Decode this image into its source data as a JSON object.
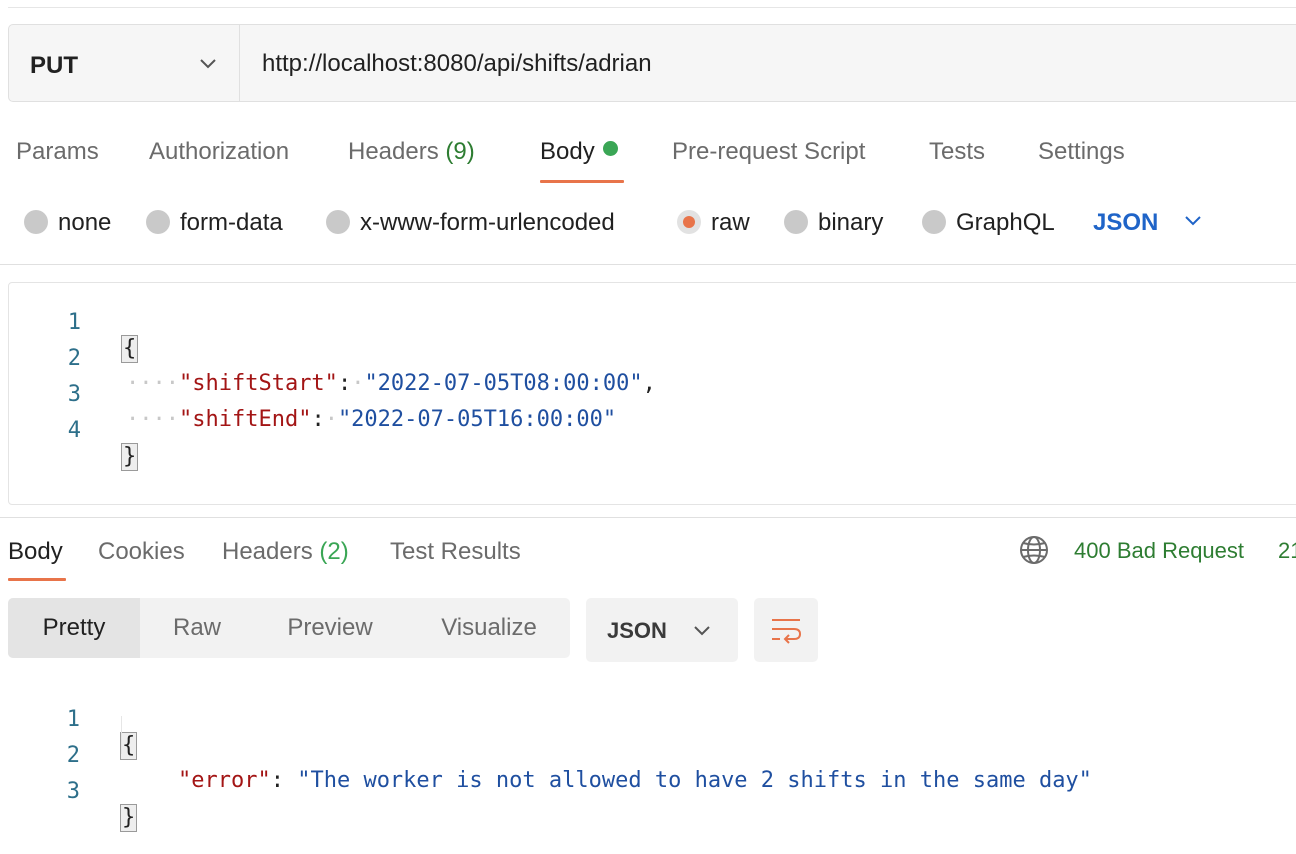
{
  "request": {
    "method": "PUT",
    "url": "http://localhost:8080/api/shifts/adrian",
    "tabs": [
      {
        "label": "Params"
      },
      {
        "label": "Authorization"
      },
      {
        "label": "Headers",
        "count": "(9)"
      },
      {
        "label": "Body",
        "active": true,
        "has_indicator": true
      },
      {
        "label": "Pre-request Script"
      },
      {
        "label": "Tests"
      },
      {
        "label": "Settings"
      }
    ],
    "body_types": [
      "none",
      "form-data",
      "x-www-form-urlencoded",
      "raw",
      "binary",
      "GraphQL"
    ],
    "selected_body_type": "raw",
    "language": "JSON",
    "code_lines": {
      "l1": {
        "num": "1",
        "open": "{"
      },
      "l2": {
        "num": "2",
        "dots": "····",
        "key": "\"shiftStart\"",
        "colon": ":",
        "sp": "·",
        "value": "\"2022-07-05T08:00:00\"",
        "comma": ","
      },
      "l3": {
        "num": "3",
        "dots": "····",
        "key": "\"shiftEnd\"",
        "colon": ":",
        "sp": "·",
        "value": "\"2022-07-05T16:00:00\""
      },
      "l4": {
        "num": "4",
        "close": "}"
      }
    }
  },
  "response": {
    "tabs": [
      {
        "label": "Body",
        "active": true
      },
      {
        "label": "Cookies"
      },
      {
        "label": "Headers",
        "count": "(2)"
      },
      {
        "label": "Test Results"
      }
    ],
    "status": "400 Bad Request",
    "status_extra": "21",
    "view_modes": [
      "Pretty",
      "Raw",
      "Preview",
      "Visualize"
    ],
    "active_view": "Pretty",
    "format": "JSON",
    "code_lines": {
      "l1": {
        "num": "1",
        "open": "{"
      },
      "l2": {
        "num": "2",
        "key": "\"error\"",
        "colon": ":",
        "value": "\"The worker is not allowed to have 2 shifts in the same day\""
      },
      "l3": {
        "num": "3",
        "close": "}"
      }
    }
  },
  "icons": {
    "method_dropdown": "chevron-down-icon",
    "language_dropdown": "chevron-down-icon",
    "status": "globe-icon",
    "wrap": "wrap-lines-icon"
  },
  "colors": {
    "accent": "#e8744a",
    "status_ok_green": "#2e7d32",
    "link_blue": "#1f64c8",
    "json_key": "#a31515",
    "json_string": "#1f4fa0"
  }
}
